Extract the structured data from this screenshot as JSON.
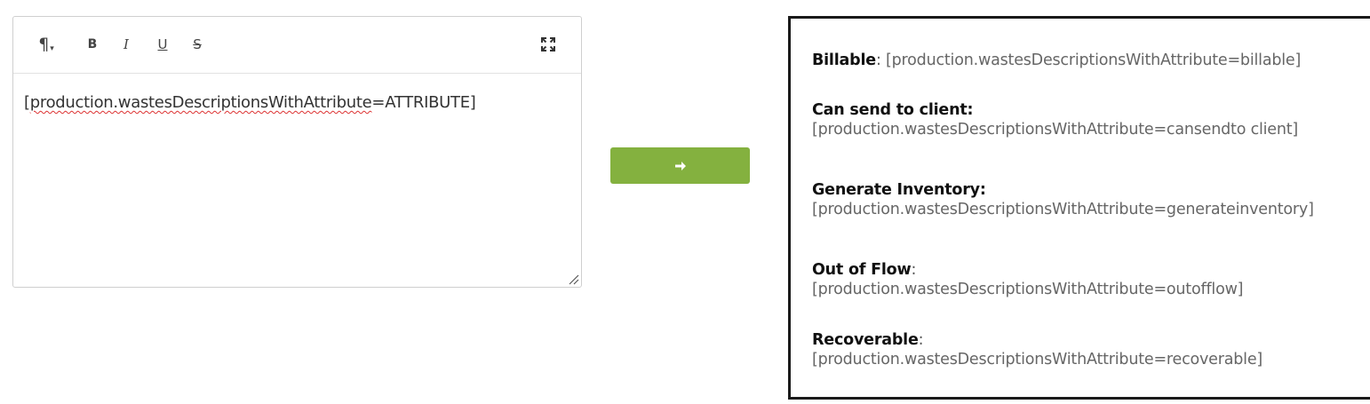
{
  "editor": {
    "toolbar": {
      "paragraph_icon": "pilcrow-icon",
      "bold_label": "B",
      "italic_label": "I",
      "underline_label": "U",
      "strike_label": "S",
      "fullscreen_icon": "fullscreen-icon"
    },
    "content": {
      "prefix": "[",
      "misspelled": "production.wastesDescriptionsWithAttribute",
      "suffix": "=ATTRIBUTE]"
    }
  },
  "convert_button": {
    "icon": "arrow-right-icon",
    "color": "#84b13f"
  },
  "output": {
    "entries": [
      {
        "label": "Billable",
        "sep": ": ",
        "value": "[production.wastesDescriptionsWithAttribute=billable]"
      },
      {
        "label": "Can send to client:",
        "sep": "",
        "value": "[production.wastesDescriptionsWithAttribute=cansendto client]"
      },
      {
        "label": "Generate Inventory:",
        "sep": "",
        "value": "[production.wastesDescriptionsWithAttribute=generateinventory]"
      },
      {
        "label": "Out of Flow",
        "sep": ":",
        "value": "[production.wastesDescriptionsWithAttribute=outofflow]"
      },
      {
        "label": "Recoverable",
        "sep": ":",
        "value": "[production.wastesDescriptionsWithAttribute=recoverable]"
      }
    ]
  }
}
